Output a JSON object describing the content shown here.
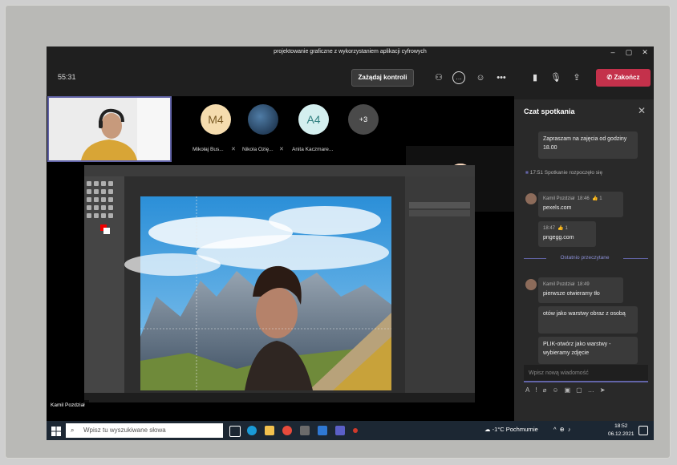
{
  "window": {
    "title": "projektowanie graficzne z wykorzystaniem aplikacji cyfrowych"
  },
  "toolbar": {
    "timer": "55:31",
    "request_control": "Zażądaj kontroli",
    "end_label": "Zakończ",
    "accent": "#6264a7",
    "end_color": "#c4314b"
  },
  "participants": [
    {
      "initials": "M4",
      "name": "Mikołaj Bus...",
      "color": "#f5dcae"
    },
    {
      "initials": "",
      "name": "Nikola Ozię...",
      "color": "#2b3f5c"
    },
    {
      "initials": "A4",
      "name": "Anita Kaczmare...",
      "color": "#d4efef"
    },
    {
      "initials": "+3",
      "name": "",
      "color": "#4a4a4a"
    }
  ],
  "presenter": {
    "name": "Kamil Pozdział"
  },
  "chat": {
    "title": "Czat spotkania",
    "messages": [
      {
        "text": "Zapraszam na zajęcia od godziny 18.00"
      },
      {
        "system": "17:51  Spotkanie rozpoczęło się"
      },
      {
        "author": "Kamil Pozdział",
        "time": "18:46",
        "reaction": "👍 1",
        "text": "pexels.com"
      },
      {
        "time": "18:47",
        "reaction": "👍 1",
        "text": "pngegg.com"
      },
      {
        "divider": "Ostatnio przeczytane"
      },
      {
        "author": "Kamil Pozdział",
        "time": "18:49",
        "text": "pierwsze otwieramy tło"
      },
      {
        "text": "otów jako warstwy obraz z osobą"
      },
      {
        "text": "PLIK-otwórz jako warstwy - wybieramy zdjęcie"
      }
    ],
    "input_placeholder": "Wpisz nową wiadomość"
  },
  "taskbar": {
    "search_placeholder": "Wpisz tu wyszukiwane słowa",
    "weather": "-1°C  Pochmurnie",
    "time": "18:52",
    "date": "06.12.2021"
  }
}
